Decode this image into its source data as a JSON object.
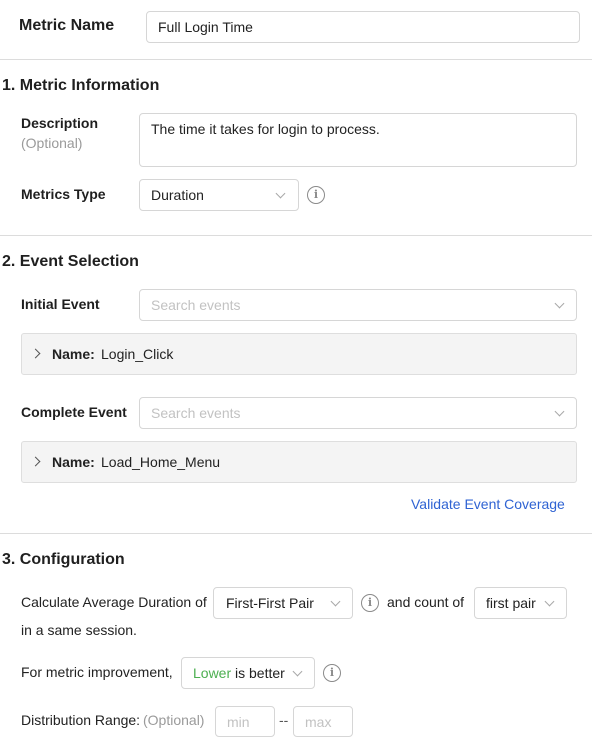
{
  "header": {
    "metric_name_label": "Metric Name",
    "metric_name_value": "Full Login Time"
  },
  "section1": {
    "title": "1. Metric Information",
    "description_label": "Description",
    "description_optional": "(Optional)",
    "description_value": "The time it takes for login to process.",
    "metrics_type_label": "Metrics Type",
    "metrics_type_value": "Duration"
  },
  "section2": {
    "title": "2. Event Selection",
    "initial_event_label": "Initial Event",
    "initial_event_placeholder": "Search events",
    "initial_event_name_key": "Name:",
    "initial_event_name_value": "Login_Click",
    "complete_event_label": "Complete Event",
    "complete_event_placeholder": "Search events",
    "complete_event_name_key": "Name:",
    "complete_event_name_value": "Load_Home_Menu",
    "validate_link": "Validate Event Coverage"
  },
  "section3": {
    "title": "3. Configuration",
    "calc_prefix": "Calculate Average Duration of",
    "pair_select_value": "First-First Pair",
    "count_label": "and count of",
    "count_select_value": "first pair",
    "session_text": "in a same session.",
    "improvement_label": "For metric improvement,",
    "improvement_lower": "Lower",
    "improvement_rest": "is better",
    "distribution_label": "Distribution Range:",
    "distribution_optional": "(Optional)",
    "min_placeholder": "min",
    "range_separator": "--",
    "max_placeholder": "max"
  },
  "colors": {
    "accent_link": "#2f63d3",
    "lower_green": "#4caf50"
  },
  "icons": [
    "info-icon",
    "chevron-down-icon",
    "chevron-right-icon"
  ]
}
